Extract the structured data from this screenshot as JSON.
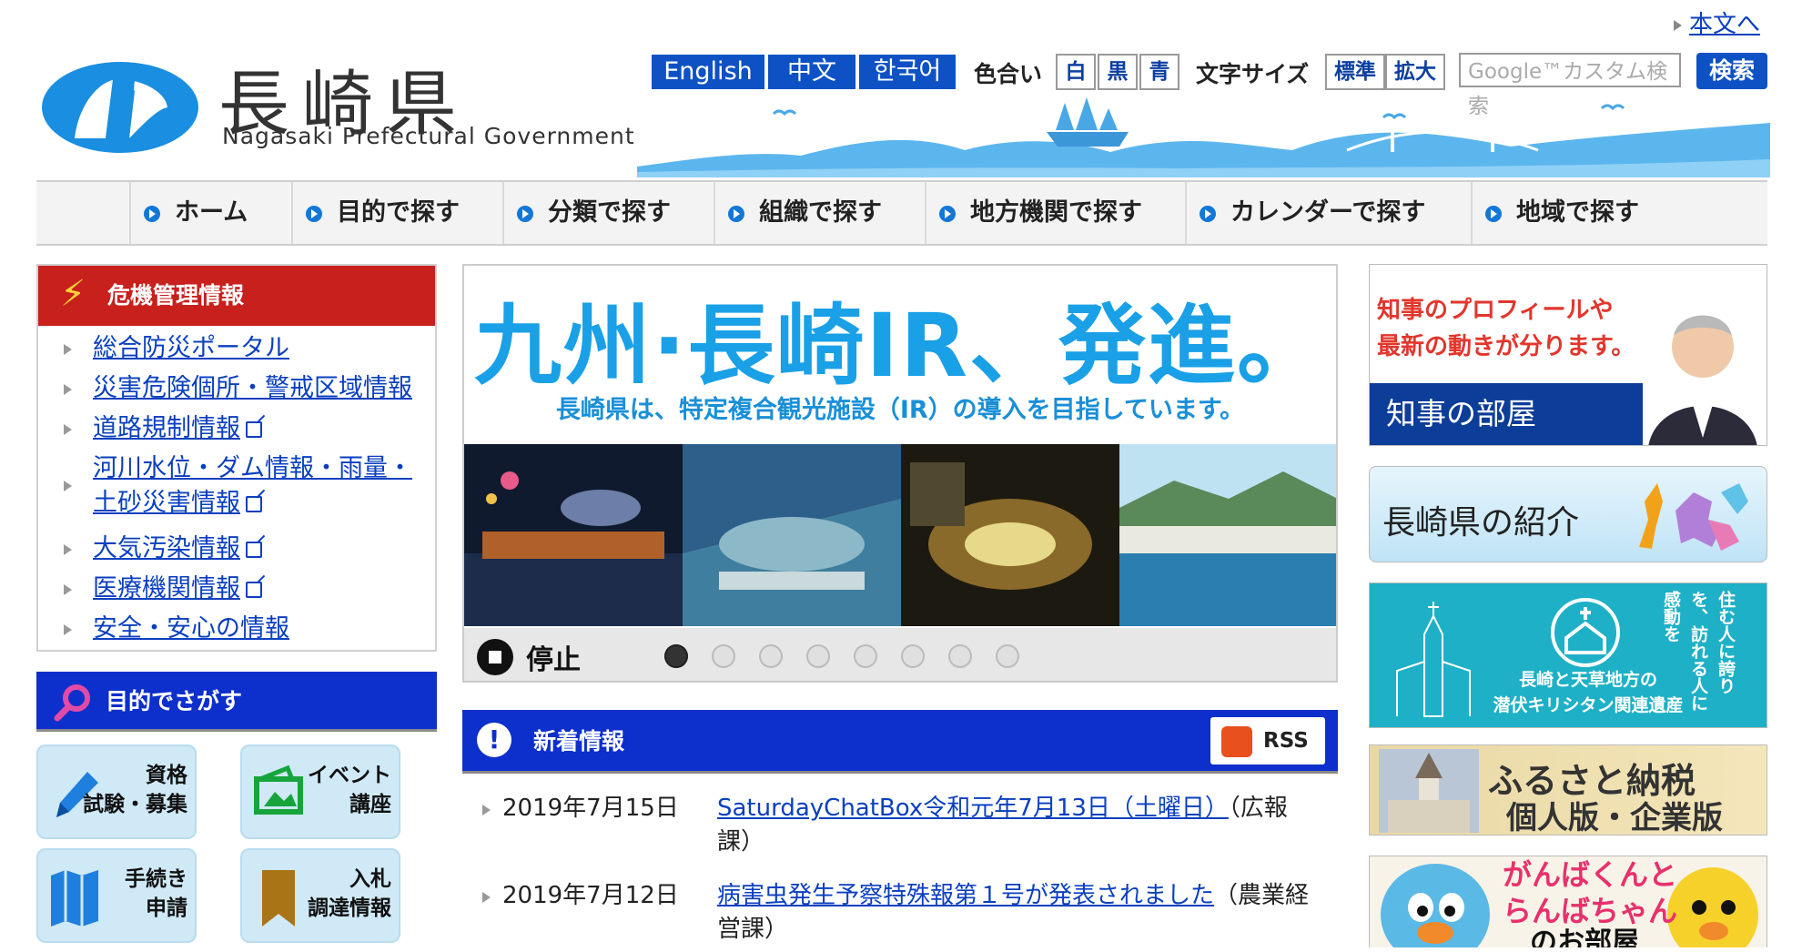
{
  "header": {
    "skip_link": "本文へ",
    "title": "長崎県",
    "subtitle": "Nagasaki Prefectural Government",
    "languages": [
      "English",
      "中文",
      "한국어"
    ],
    "color_label": "色合い",
    "colors": [
      "白",
      "黒",
      "青"
    ],
    "fontsize_label": "文字サイズ",
    "fontsizes": [
      "標準",
      "拡大"
    ],
    "search_placeholder": "Google™カスタム検索",
    "search_button": "検索",
    "accent_color": "#0d51c4"
  },
  "nav": {
    "items": [
      "ホーム",
      "目的で探す",
      "分類で探す",
      "組織で探す",
      "地方機関で探す",
      "カレンダーで探す",
      "地域で探す"
    ]
  },
  "crisis": {
    "title": "危機管理情報",
    "links": [
      {
        "label": "総合防災ポータル",
        "external": false
      },
      {
        "label": "災害危険個所・警戒区域情報",
        "external": false
      },
      {
        "label": "道路規制情報",
        "external": true
      },
      {
        "label": "河川水位・ダム情報・雨量・",
        "label2": "土砂災害情報",
        "external": true
      },
      {
        "label": "大気汚染情報",
        "external": true
      },
      {
        "label": "医療機関情報",
        "external": true
      },
      {
        "label": "安全・安心の情報",
        "external": false
      }
    ]
  },
  "purpose": {
    "title": "目的でさがす",
    "tiles": [
      {
        "line1": "資格",
        "line2": "試験・募集",
        "icon": "pencil-icon"
      },
      {
        "line1": "イベント",
        "line2": "講座",
        "icon": "event-icon"
      },
      {
        "line1": "手続き",
        "line2": "申請",
        "icon": "map-icon"
      },
      {
        "line1": "入札",
        "line2": "調達情報",
        "icon": "bookmark-icon"
      }
    ]
  },
  "hero": {
    "title": "九州·長崎IR、発進。",
    "subtitle": "長崎県は、特定複合観光施設（IR）の導入を目指しています。",
    "stop_label": "停止",
    "slide_count": 8,
    "active_slide": 1
  },
  "news": {
    "title": "新着情報",
    "rss_label": "RSS",
    "items": [
      {
        "date": "2019年7月15日",
        "link": "SaturdayChatBox令和元年7月13日（土曜日）",
        "dept": "（広報課）"
      },
      {
        "date": "2019年7月12日",
        "link": "病害虫発生予察特殊報第１号が発表されました",
        "dept": "（農業経営課）"
      }
    ]
  },
  "banners": {
    "governor": {
      "line1": "知事のプロフィールや",
      "line2": "最新の動きが分ります。",
      "room": "知事の部屋"
    },
    "intro": {
      "label": "長崎県の紹介"
    },
    "heritage": {
      "line1": "長崎と天草地方の",
      "line2": "潜伏キリシタン関連遺産",
      "vertical": "住む人に誇りを、訪れる人に感動を"
    },
    "furusato": {
      "line1": "ふるさと納税",
      "line2": "個人版・企業版"
    },
    "mascot": {
      "line1": "がんばくんと",
      "line2": "らんばちゃん",
      "line3": "のお部屋"
    }
  }
}
